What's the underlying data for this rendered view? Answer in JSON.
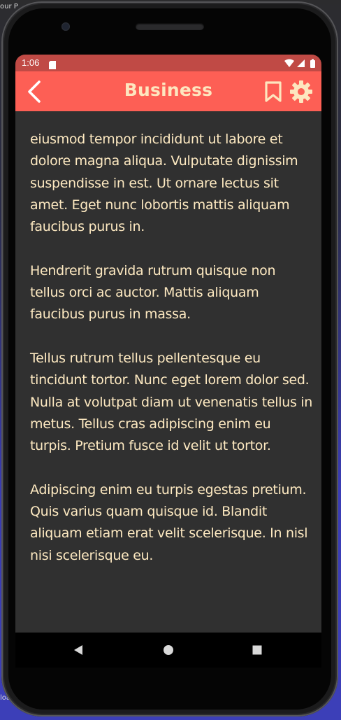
{
  "status_bar": {
    "time": "1:06",
    "sd_icon": "sd-card-icon",
    "wifi_icon": "wifi-icon",
    "signal_icon": "signal-icon",
    "battery_icon": "battery-icon"
  },
  "app_bar": {
    "title": "Business",
    "back_icon": "arrow-back-icon",
    "bookmark_icon": "bookmark-outline-icon",
    "settings_icon": "gear-icon"
  },
  "article": {
    "paragraphs": [
      "eiusmod tempor incididunt ut labore et dolore magna aliqua. Vulputate dignissim suspendisse in est. Ut ornare lectus sit amet. Eget nunc lobortis mattis aliquam faucibus purus in.",
      "Hendrerit gravida rutrum quisque non tellus orci ac auctor. Mattis aliquam faucibus purus in massa.",
      "Tellus rutrum tellus pellentesque eu tincidunt tortor. Nunc eget lorem dolor sed. Nulla at volutpat diam ut venenatis tellus in metus. Tellus cras adipiscing enim eu turpis. Pretium fusce id velit ut tortor.",
      "Adipiscing enim eu turpis egestas pretium. Quis varius quam quisque id. Blandit aliquam etiam erat velit scelerisque. In nisl nisi scelerisque eu."
    ]
  },
  "nav_bar": {
    "back_icon": "triangle-back-icon",
    "home_icon": "circle-home-icon",
    "recents_icon": "square-recents-icon"
  },
  "background_window": {
    "top_text": "our P",
    "bottom_text": "loa"
  },
  "colors": {
    "status_bar": "#c04a45",
    "app_bar": "#fd5f55",
    "title_text": "#fde6bf",
    "content_bg": "#303030",
    "body_text": "#fde9c1",
    "nav_bar": "#000000"
  }
}
